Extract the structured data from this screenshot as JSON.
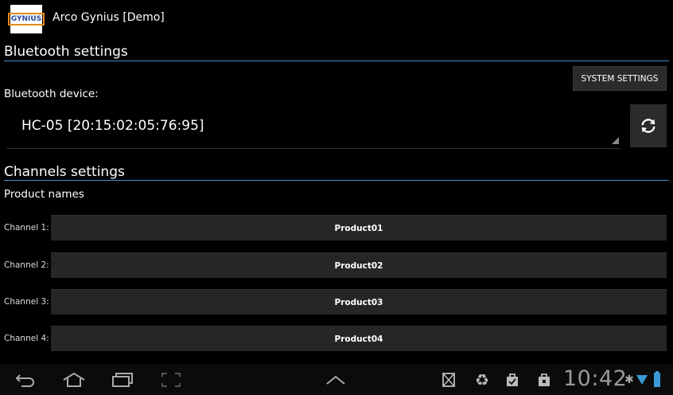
{
  "app": {
    "title": "Arco Gynius [Demo]",
    "logo_text": "GYNIUS"
  },
  "bluetooth": {
    "section_title": "Bluetooth settings",
    "system_settings_label": "SYSTEM SETTINGS",
    "device_label": "Bluetooth device:",
    "selected_device": "HC-05 [20:15:02:05:76:95]"
  },
  "channels": {
    "section_title": "Channels settings",
    "product_names_label": "Product names",
    "items": [
      {
        "label": "Channel 1:",
        "value": "Product01"
      },
      {
        "label": "Channel 2:",
        "value": "Product02"
      },
      {
        "label": "Channel 3:",
        "value": "Product03"
      },
      {
        "label": "Channel 4:",
        "value": "Product04"
      }
    ]
  },
  "status_bar": {
    "time": "10:42"
  },
  "colors": {
    "accent": "#3a8fd0",
    "logo_border": "#e88a1a",
    "logo_text": "#2a4aa0"
  }
}
